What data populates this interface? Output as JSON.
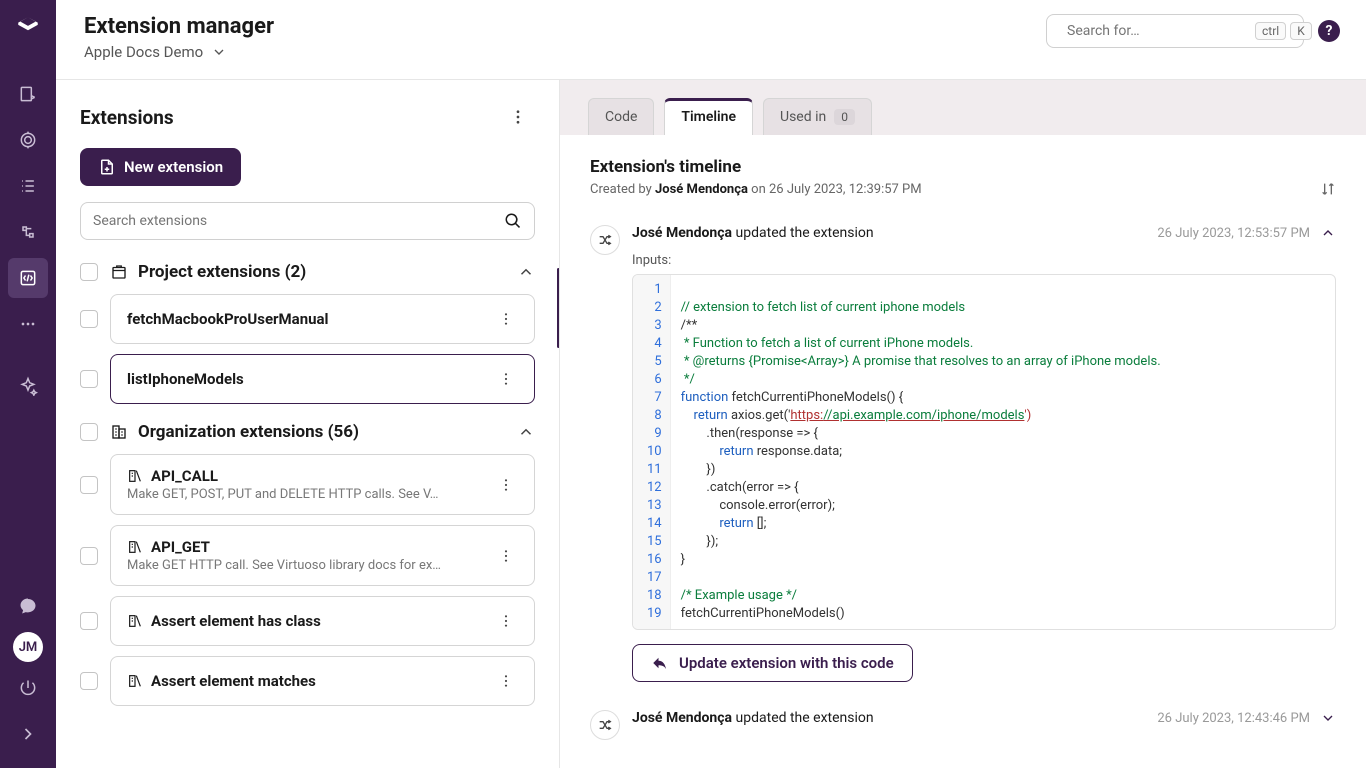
{
  "header": {
    "title": "Extension manager",
    "breadcrumb": "Apple Docs Demo",
    "search_placeholder": "Search for…",
    "kbd1": "ctrl",
    "kbd2": "K"
  },
  "navrail": {
    "avatar_initials": "JM"
  },
  "left": {
    "heading": "Extensions",
    "new_button": "New extension",
    "search_placeholder": "Search extensions",
    "groups": [
      {
        "title": "Project extensions",
        "count": "(2)",
        "items": [
          {
            "name": "fetchMacbookProUserManual",
            "desc": "",
            "icon": false,
            "selected": false
          },
          {
            "name": "listIphoneModels",
            "desc": "",
            "icon": false,
            "selected": true
          }
        ]
      },
      {
        "title": "Organization extensions",
        "count": "(56)",
        "items": [
          {
            "name": "API_CALL",
            "desc": "Make GET, POST, PUT and DELETE HTTP calls. See V…",
            "icon": true,
            "selected": false
          },
          {
            "name": "API_GET",
            "desc": "Make GET HTTP call. See Virtuoso library docs for ex…",
            "icon": true,
            "selected": false
          },
          {
            "name": "Assert element has class",
            "desc": "",
            "icon": true,
            "selected": false
          },
          {
            "name": "Assert element matches",
            "desc": "",
            "icon": true,
            "selected": false
          }
        ]
      }
    ]
  },
  "right": {
    "tabs": {
      "code": "Code",
      "timeline": "Timeline",
      "usedin": "Used in",
      "usedin_count": "0"
    },
    "panel": {
      "title": "Extension's timeline",
      "created_prefix": "Created by ",
      "created_by": "José Mendonça",
      "created_rest": " on 26 July 2023, 12:39:57 PM"
    },
    "events": [
      {
        "who": "José Mendonça",
        "action": " updated the extension",
        "when": "26 July 2023, 12:53:57 PM",
        "expanded": true,
        "inputs_label": "Inputs:",
        "update_label": "Update extension with this code"
      },
      {
        "who": "José Mendonça",
        "action": " updated the extension",
        "when": "26 July 2023, 12:43:46 PM",
        "expanded": false
      }
    ],
    "code_lines": [
      "",
      "// extension to fetch list of current iphone models",
      "/**",
      " * Function to fetch a list of current iPhone models.",
      " * @returns {Promise<Array>} A promise that resolves to an array of iPhone models.",
      " */",
      "function fetchCurrentiPhoneModels() {",
      "    return axios.get('https://api.example.com/iphone/models')",
      "        .then(response => {",
      "            return response.data;",
      "        })",
      "        .catch(error => {",
      "            console.error(error);",
      "            return [];",
      "        });",
      "}",
      "",
      "/* Example usage */",
      "fetchCurrentiPhoneModels()"
    ]
  }
}
